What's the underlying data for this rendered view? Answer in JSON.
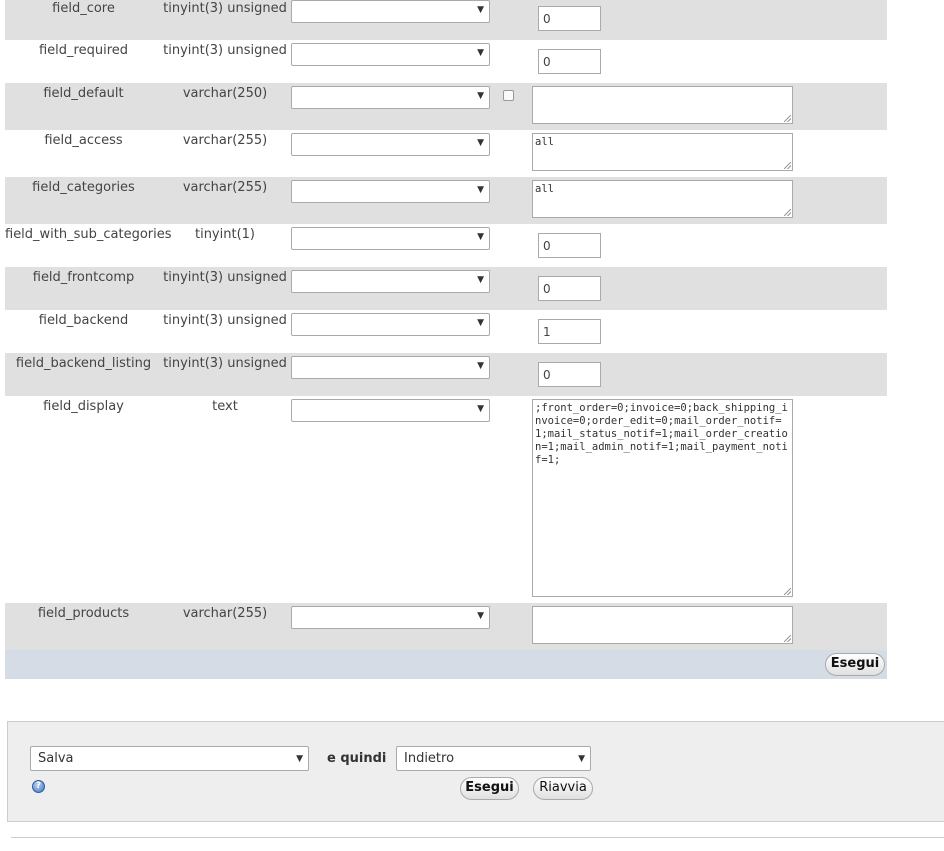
{
  "rows": [
    {
      "name": "field_core",
      "type": "tinyint(3) unsigned",
      "value": "0"
    },
    {
      "name": "field_required",
      "type": "tinyint(3) unsigned",
      "value": "0"
    },
    {
      "name": "field_default",
      "type": "varchar(250)",
      "value": ""
    },
    {
      "name": "field_access",
      "type": "varchar(255)",
      "value": "all"
    },
    {
      "name": "field_categories",
      "type": "varchar(255)",
      "value": "all"
    },
    {
      "name": "field_with_sub_categories",
      "type": "tinyint(1)",
      "value": "0"
    },
    {
      "name": "field_frontcomp",
      "type": "tinyint(3) unsigned",
      "value": "0"
    },
    {
      "name": "field_backend",
      "type": "tinyint(3) unsigned",
      "value": "1"
    },
    {
      "name": "field_backend_listing",
      "type": "tinyint(3) unsigned",
      "value": "0"
    },
    {
      "name": "field_display",
      "type": "text",
      "value": ";front_order=0;invoice=0;back_shipping_invoice=0;order_edit=0;mail_order_notif=1;mail_status_notif=1;mail_order_creation=1;mail_admin_notif=1;mail_payment_notif=1;"
    },
    {
      "name": "field_products",
      "type": "varchar(255)",
      "value": ""
    }
  ],
  "submit_row": {
    "go_label": "Esegui"
  },
  "bottom": {
    "action_value": "Salva",
    "then_label": "e quindi",
    "after_value": "Indietro",
    "go_label": "Esegui",
    "reset_label": "Riavvia",
    "help_icon_glyph": "?"
  },
  "icons": {
    "dropdown": "chevron-down-icon",
    "help": "help-icon"
  }
}
